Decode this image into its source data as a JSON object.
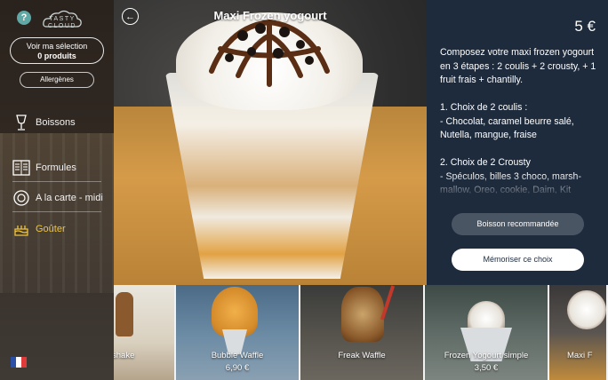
{
  "sidebar": {
    "help_icon_glyph": "?",
    "logo_text_line1": "TASTY",
    "logo_text_line2": "CLOUD",
    "selection_label": "Voir ma sélection",
    "selection_count": "0 produits",
    "allergens_label": "Allergènes",
    "menu": [
      {
        "label": "Boissons",
        "icon": "glass-icon"
      },
      {
        "label": "Formules",
        "icon": "menu-book-icon"
      },
      {
        "label": "A la carte - midi",
        "icon": "plate-icon"
      },
      {
        "label": "Goûter",
        "icon": "cake-icon",
        "active": true
      }
    ],
    "language_flag": "fr-flag-icon"
  },
  "product": {
    "title": "Maxi Frozen yogourt",
    "price": "5 €",
    "description": "Composez votre maxi frozen yogourt en 3 étapes :  2 coulis + 2 crousty, + 1 fruit frais + chantilly.\n\n1. Choix de 2 coulis :\n- Chocolat, caramel beurre salé, Nutella, mangue, fraise\n\n2. Choix de 2 Crousty\n- Spéculos, billes 3 choco, marsh-mallow, Oreo, cookie, Daim, Kit",
    "recommend_button": "Boisson recommandée",
    "save_button": "Mémoriser ce choix"
  },
  "strip": [
    {
      "label": "shake",
      "price": ""
    },
    {
      "label": "Bubble Waffle",
      "price": "6,90 €"
    },
    {
      "label": "Freak Waffle",
      "price": ""
    },
    {
      "label": "Frozen Yogourt simple",
      "price": "3,50 €"
    },
    {
      "label": "Maxi F",
      "price": ""
    }
  ],
  "colors": {
    "panel": "#1e2b3d",
    "active_menu": "#f0c43a",
    "help_icon": "#5fa8a6"
  }
}
